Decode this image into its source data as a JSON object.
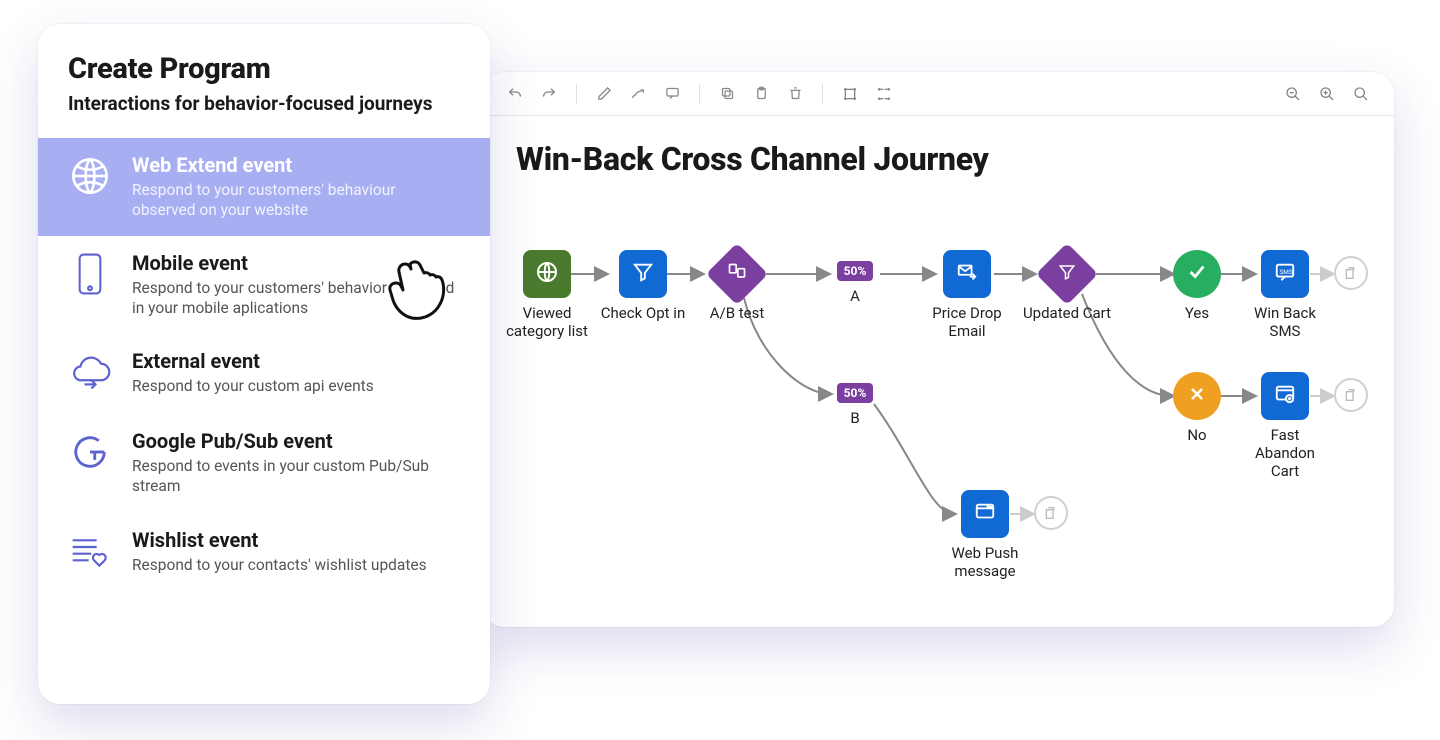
{
  "sidecard": {
    "title": "Create Program",
    "subtitle": "Interactions for behavior-focused journeys",
    "items": [
      {
        "title": "Web Extend event",
        "desc": "Respond to your customers' behaviour observed on your website",
        "selected": true
      },
      {
        "title": "Mobile event",
        "desc": "Respond to your customers' behavior observed in your mobile aplications"
      },
      {
        "title": "External event",
        "desc": "Respond to your custom api events"
      },
      {
        "title": "Google Pub/Sub event",
        "desc": "Respond to events in your custom Pub/Sub stream"
      },
      {
        "title": "Wishlist event",
        "desc": "Respond to your contacts' wishlist updates"
      }
    ]
  },
  "canvas": {
    "title": "Win-Back Cross Channel Journey",
    "nodes": {
      "viewed": "Viewed category list",
      "checkopt": "Check Opt in",
      "abtest": "A/B test",
      "a": "A",
      "a_pct": "50%",
      "b": "B",
      "b_pct": "50%",
      "priceDrop": "Price Drop Email",
      "updatedCart": "Updated Cart",
      "yes": "Yes",
      "no": "No",
      "winback": "Win Back SMS",
      "fastAbandon": "Fast Abandon Cart",
      "webpush": "Web Push message"
    }
  }
}
